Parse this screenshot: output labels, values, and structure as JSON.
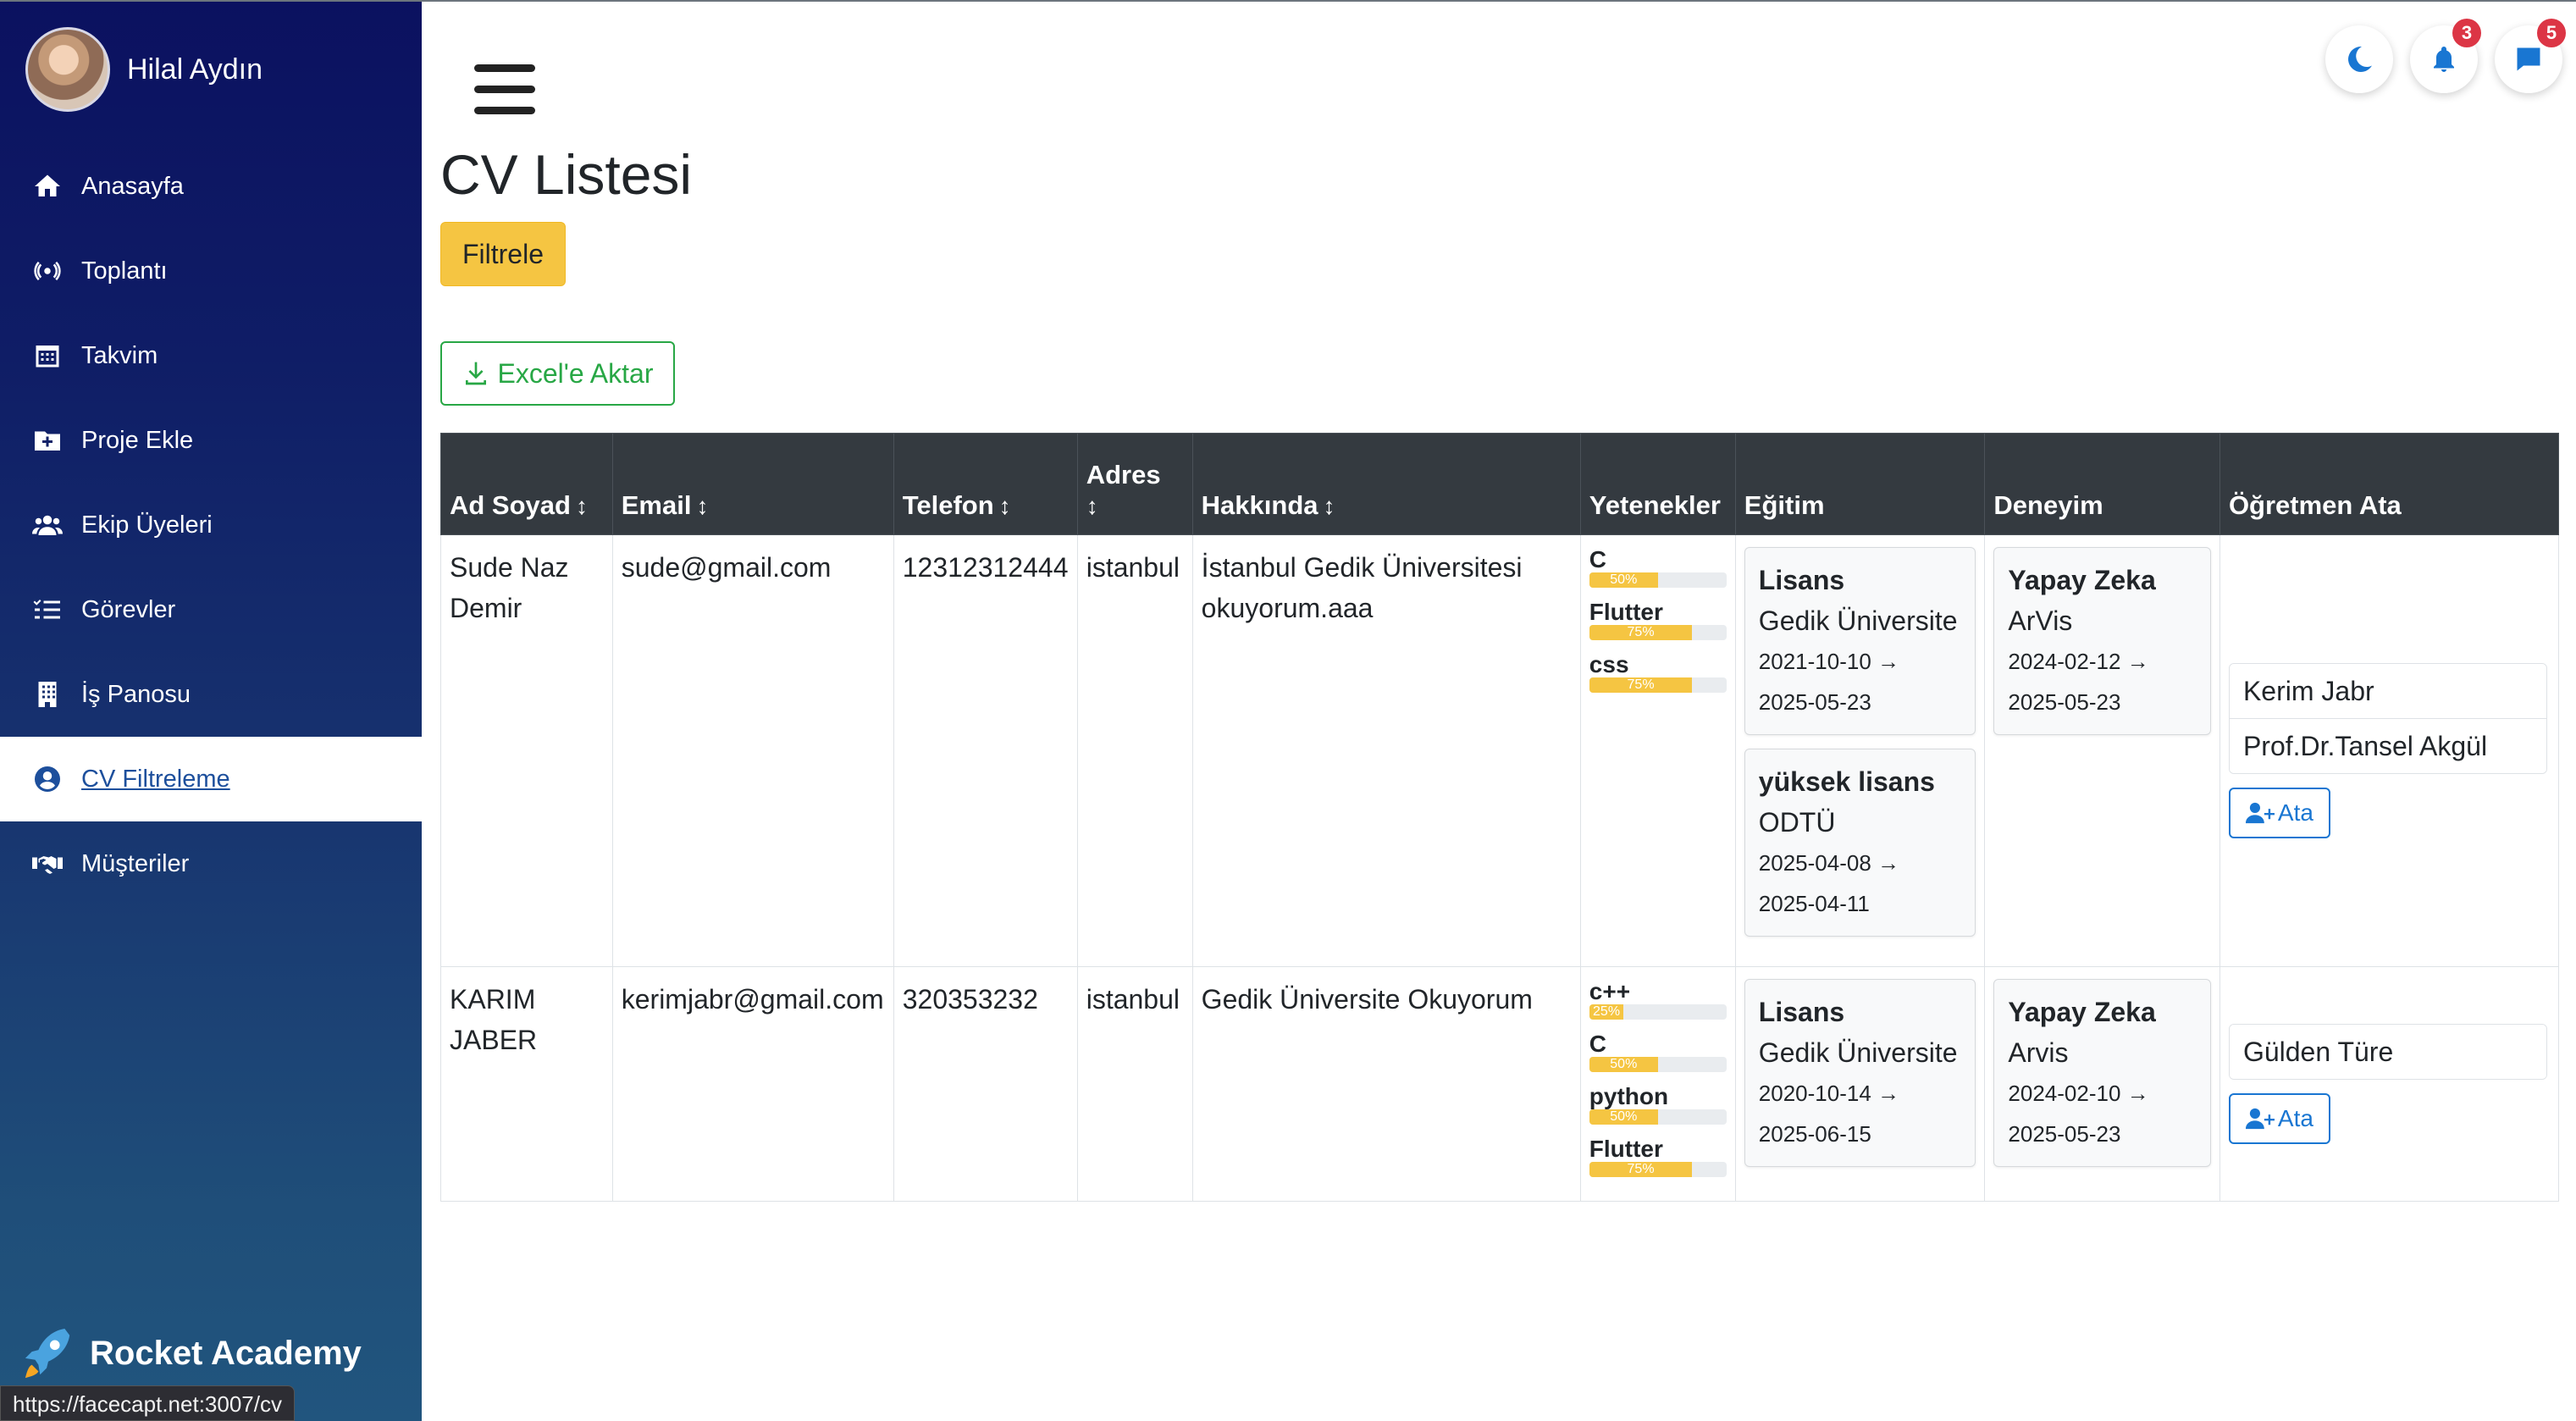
{
  "profile": {
    "name": "Hilal Aydın"
  },
  "sidebar": {
    "items": [
      {
        "label": "Anasayfa",
        "icon": "home-icon",
        "active": false
      },
      {
        "label": "Toplantı",
        "icon": "broadcast-icon",
        "active": false
      },
      {
        "label": "Takvim",
        "icon": "calendar-icon",
        "active": false
      },
      {
        "label": "Proje Ekle",
        "icon": "folder-plus-icon",
        "active": false
      },
      {
        "label": "Ekip Üyeleri",
        "icon": "users-icon",
        "active": false
      },
      {
        "label": "Görevler",
        "icon": "list-check-icon",
        "active": false
      },
      {
        "label": "İş Panosu",
        "icon": "building-icon",
        "active": false
      },
      {
        "label": "CV Filtreleme",
        "icon": "user-circle-icon",
        "active": true
      },
      {
        "label": "Müşteriler",
        "icon": "handshake-icon",
        "active": false
      }
    ],
    "brand": "Rocket Academy"
  },
  "status_url": "https://facecapt.net:3007/cv",
  "topbar": {
    "notifications_count": "3",
    "messages_count": "5"
  },
  "page": {
    "title": "CV Listesi",
    "filter_label": "Filtrele",
    "export_label": "Excel'e Aktar"
  },
  "table": {
    "headers": {
      "name": "Ad Soyad",
      "email": "Email",
      "phone": "Telefon",
      "address": "Adres",
      "about": "Hakkında",
      "skills": "Yetenekler",
      "education": "Eğitim",
      "experience": "Deneyim",
      "assign": "Öğretmen Ata",
      "sort_icon": "↕"
    },
    "assign_label": "Ata",
    "rows": [
      {
        "name": "Sude Naz Demir",
        "email": "sude@gmail.com",
        "phone": "12312312444",
        "address": "istanbul",
        "about": "İstanbul Gedik Üniversitesi okuyorum.aaa",
        "skills": [
          {
            "name": "C",
            "level": "50%"
          },
          {
            "name": "Flutter",
            "level": "75%"
          },
          {
            "name": "css",
            "level": "75%"
          }
        ],
        "education": [
          {
            "degree": "Lisans",
            "school": "Gedik Üniversite",
            "dates": "2021-10-10 → 2025-05-23"
          },
          {
            "degree": "yüksek lisans",
            "school": "ODTÜ",
            "dates": "2025-04-08 → 2025-04-11"
          }
        ],
        "experience": [
          {
            "title": "Yapay Zeka",
            "company": "ArVis",
            "dates": "2024-02-12 → 2025-05-23"
          }
        ],
        "teachers": [
          "Kerim Jabr",
          "Prof.Dr.Tansel Akgül"
        ]
      },
      {
        "name": "KARIM JABER",
        "email": "kerimjabr@gmail.com",
        "phone": "320353232",
        "address": "istanbul",
        "about": "Gedik Üniversite Okuyorum",
        "skills": [
          {
            "name": "c++",
            "level": "25%"
          },
          {
            "name": "C",
            "level": "50%"
          },
          {
            "name": "python",
            "level": "50%"
          },
          {
            "name": "Flutter",
            "level": "75%"
          }
        ],
        "education": [
          {
            "degree": "Lisans",
            "school": "Gedik Üniversite",
            "dates": "2020-10-14 → 2025-06-15"
          }
        ],
        "experience": [
          {
            "title": "Yapay Zeka",
            "company": "Arvis",
            "dates": "2024-02-10 → 2025-05-23"
          }
        ],
        "teachers": [
          "Gülden Türe"
        ]
      }
    ]
  }
}
